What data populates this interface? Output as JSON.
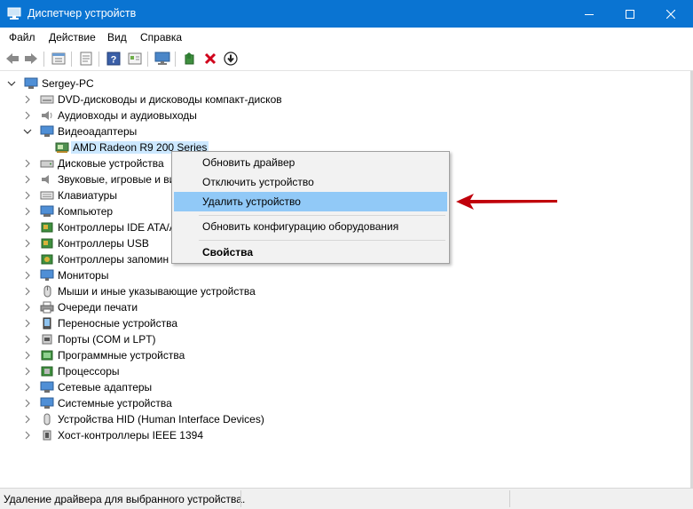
{
  "window": {
    "title": "Диспетчер устройств",
    "icon": "device-manager-icon"
  },
  "menu": [
    "Файл",
    "Действие",
    "Вид",
    "Справка"
  ],
  "toolbar": {
    "buttons": [
      "back-icon",
      "forward-icon",
      "properties-icon",
      "update-driver-icon",
      "help-icon",
      "show-hidden-icon",
      "monitor-icon",
      "enable-device-icon",
      "uninstall-icon",
      "download-driver-icon"
    ]
  },
  "tree": {
    "root": "Sergey-PC",
    "categories": [
      {
        "label": "DVD-дисководы и дисководы компакт-дисков",
        "icon": "dvd-drive-icon"
      },
      {
        "label": "Аудиовходы и аудиовыходы",
        "icon": "speaker-icon"
      },
      {
        "label": "Видеоадаптеры",
        "icon": "display-adapter-icon",
        "expanded": true
      },
      {
        "label": "Дисковые устройства",
        "icon": "disk-drive-icon"
      },
      {
        "label": "Звуковые, игровые и ви",
        "icon": "sound-icon"
      },
      {
        "label": "Клавиатуры",
        "icon": "keyboard-icon"
      },
      {
        "label": "Компьютер",
        "icon": "computer-icon"
      },
      {
        "label": "Контроллеры IDE ATA/A",
        "icon": "ide-controller-icon"
      },
      {
        "label": "Контроллеры USB",
        "icon": "usb-controller-icon"
      },
      {
        "label": "Контроллеры запомин",
        "icon": "storage-controller-icon"
      },
      {
        "label": "Мониторы",
        "icon": "monitor-icon"
      },
      {
        "label": "Мыши и иные указывающие устройства",
        "icon": "mouse-icon"
      },
      {
        "label": "Очереди печати",
        "icon": "printer-icon"
      },
      {
        "label": "Переносные устройства",
        "icon": "portable-device-icon"
      },
      {
        "label": "Порты (COM и LPT)",
        "icon": "port-icon"
      },
      {
        "label": "Программные устройства",
        "icon": "software-device-icon"
      },
      {
        "label": "Процессоры",
        "icon": "processor-icon"
      },
      {
        "label": "Сетевые адаптеры",
        "icon": "network-adapter-icon"
      },
      {
        "label": "Системные устройства",
        "icon": "system-device-icon"
      },
      {
        "label": "Устройства HID (Human Interface Devices)",
        "icon": "hid-icon"
      },
      {
        "label": "Хост-контроллеры IEEE 1394",
        "icon": "ieee1394-icon"
      }
    ],
    "selected_device": "AMD Radeon R9 200 Series"
  },
  "context_menu": {
    "items": [
      {
        "label": "Обновить драйвер"
      },
      {
        "label": "Отключить устройство"
      },
      {
        "label": "Удалить устройство",
        "highlighted": true
      },
      {
        "label": "Обновить конфигурацию оборудования"
      },
      {
        "label": "Свойства",
        "bold": true
      }
    ]
  },
  "annotation": {
    "color": "#c0000b"
  },
  "status": {
    "text": "Удаление драйвера для выбранного устройства."
  },
  "colors": {
    "titlebar": "#0a74d2",
    "selection": "#cce8ff",
    "menu_highlight": "#91c9f7"
  }
}
